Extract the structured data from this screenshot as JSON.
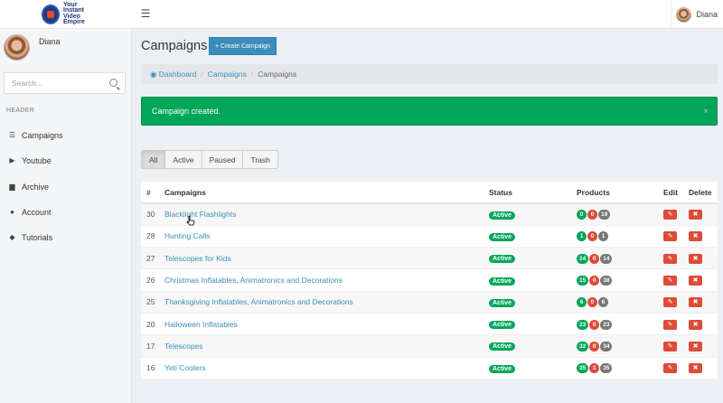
{
  "logo": {
    "lines": [
      "Your",
      "Instant",
      "Video",
      "Empire"
    ]
  },
  "topbar": {
    "user_name": "Diana"
  },
  "sidebar": {
    "user_name": "Diana",
    "search_placeholder": "Search...",
    "header_label": "HEADER",
    "items": [
      {
        "label": "Campaigns",
        "icon": "list-icon"
      },
      {
        "label": "Youtube",
        "icon": "youtube-icon"
      },
      {
        "label": "Archive",
        "icon": "archive-icon"
      },
      {
        "label": "Account",
        "icon": "user-icon"
      },
      {
        "label": "Tutorials",
        "icon": "graduation-cap-icon"
      }
    ]
  },
  "page": {
    "title": "Campaigns",
    "create_button": "+ Create Campaign"
  },
  "breadcrumb": {
    "home": "Dashboard",
    "level1": "Campaigns",
    "current": "Campaigns",
    "separator": "/"
  },
  "alert": {
    "message": "Campaign created.",
    "close": "×"
  },
  "filters": [
    "All",
    "Active",
    "Paused",
    "Trash"
  ],
  "table": {
    "headers": {
      "num": "#",
      "name": "Campaigns",
      "status": "Status",
      "products": "Products",
      "edit": "Edit",
      "delete": "Delete"
    },
    "rows": [
      {
        "id": "30",
        "name": "Blacklight Flashlights",
        "status": "Active",
        "p": [
          "0",
          "0",
          "19"
        ]
      },
      {
        "id": "28",
        "name": "Hunting Calls",
        "status": "Active",
        "p": [
          "1",
          "0",
          "1"
        ]
      },
      {
        "id": "27",
        "name": "Telescopes for Kids",
        "status": "Active",
        "p": [
          "14",
          "0",
          "14"
        ]
      },
      {
        "id": "26",
        "name": "Christmas Inflatables, Animatronics and Decorations",
        "status": "Active",
        "p": [
          "15",
          "0",
          "38"
        ]
      },
      {
        "id": "25",
        "name": "Thanksgiving Inflatables, Animatronics and Decorations",
        "status": "Active",
        "p": [
          "6",
          "0",
          "6"
        ]
      },
      {
        "id": "20",
        "name": "Halloween Inflatables",
        "status": "Active",
        "p": [
          "23",
          "0",
          "23"
        ]
      },
      {
        "id": "17",
        "name": "Telescopes",
        "status": "Active",
        "p": [
          "32",
          "0",
          "34"
        ]
      },
      {
        "id": "16",
        "name": "Yeti Coolers",
        "status": "Active",
        "p": [
          "35",
          "1",
          "35"
        ]
      }
    ]
  },
  "colors": {
    "primary": "#3c8dbc",
    "success": "#00a65a",
    "danger": "#dd4b39",
    "neutral": "#777777"
  }
}
